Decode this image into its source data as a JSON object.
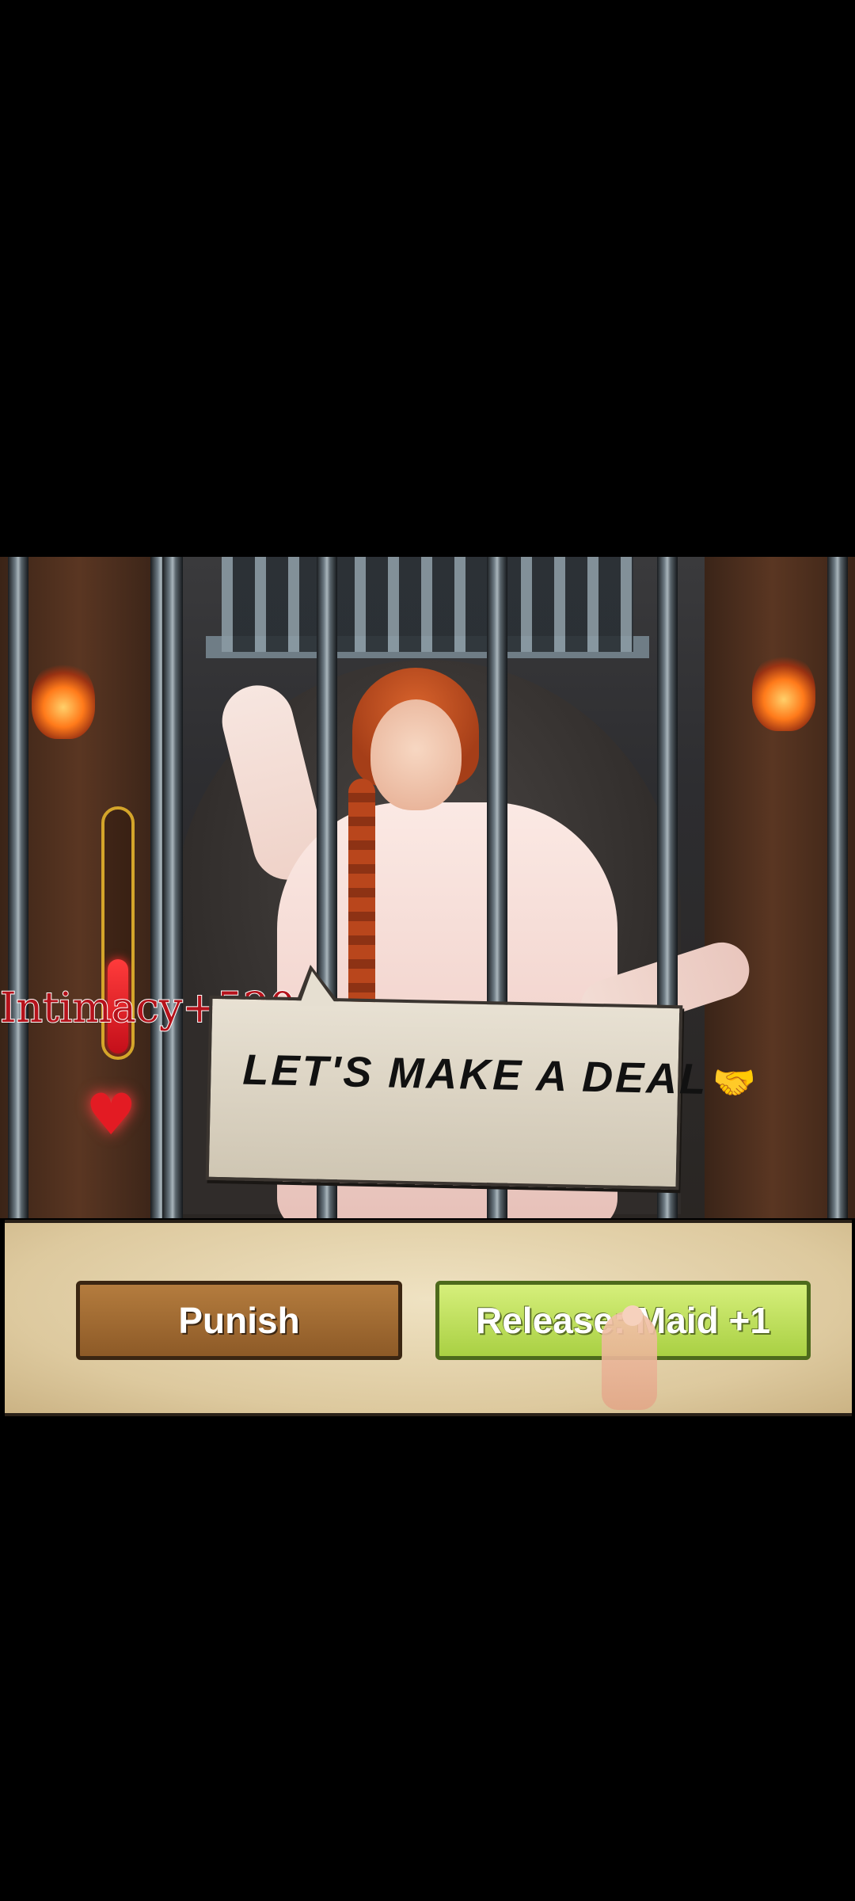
{
  "scene": {
    "intimacy_gain": "Intimacy+520",
    "intimacy_meter_level": 0.38,
    "speech_bubble": "LET'S MAKE A DEAL",
    "bubble_icon": "handshake-icon"
  },
  "choices": {
    "punish_label": "Punish",
    "release_label": "Release: Maid +1"
  },
  "colors": {
    "intimacy_text": "#b5121b",
    "punish_button": "#9c6630",
    "release_button": "#c2e260",
    "heart": "#e31b23"
  }
}
